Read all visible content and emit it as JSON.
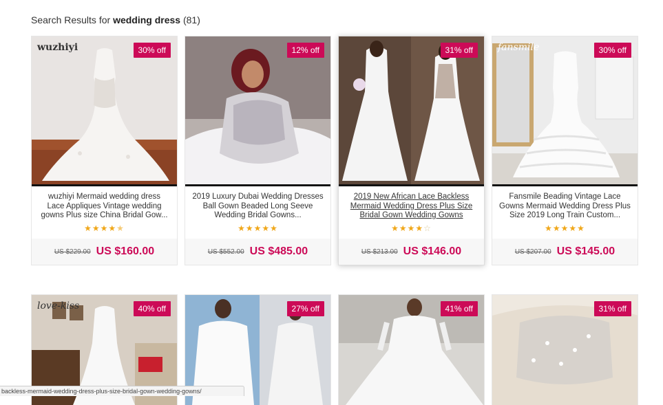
{
  "search": {
    "prefix": "Search Results for",
    "query": "wedding dress",
    "count": "(81)"
  },
  "products": [
    {
      "badge": "30% off",
      "brand": "wuzhiyi",
      "title": "wuzhiyi Mermaid wedding dress Lace Appliques Vintage wedding gowns Plus size China Bridal Gow...",
      "stars": "★★★★",
      "half": "★",
      "empty": "",
      "old_price": "US $229.00",
      "new_price": "US $160.00"
    },
    {
      "badge": "12% off",
      "brand": "",
      "title": "2019 Luxury Dubai Wedding Dresses Ball Gown Beaded Long Seeve Wedding Bridal Gowns...",
      "stars": "★★★★★",
      "half": "",
      "empty": "",
      "old_price": "US $552.00",
      "new_price": "US $485.00"
    },
    {
      "badge": "31% off",
      "brand": "",
      "title": "2019 New African Lace Backless Mermaid Wedding Dress Plus Size Bridal Gown Wedding Gowns",
      "stars": "★★★★",
      "half": "",
      "empty": "☆",
      "old_price": "US $213.00",
      "new_price": "US $146.00"
    },
    {
      "badge": "30% off",
      "brand": "fansmile",
      "title": "Fansmile Beading Vintage Lace Gowns Mermaid Wedding Dress Plus Size 2019 Long Train Custom...",
      "stars": "★★★★★",
      "half": "",
      "empty": "",
      "old_price": "US $207.00",
      "new_price": "US $145.00"
    },
    {
      "badge": "40% off",
      "brand": "love-kiss"
    },
    {
      "badge": "27% off",
      "brand": ""
    },
    {
      "badge": "41% off",
      "brand": ""
    },
    {
      "badge": "31% off",
      "brand": ""
    }
  ],
  "status_url": "backless-mermaid-wedding-dress-plus-size-bridal-gown-wedding-gowns/",
  "colors": {
    "accent": "#cc0a57",
    "star": "#f0a719"
  }
}
